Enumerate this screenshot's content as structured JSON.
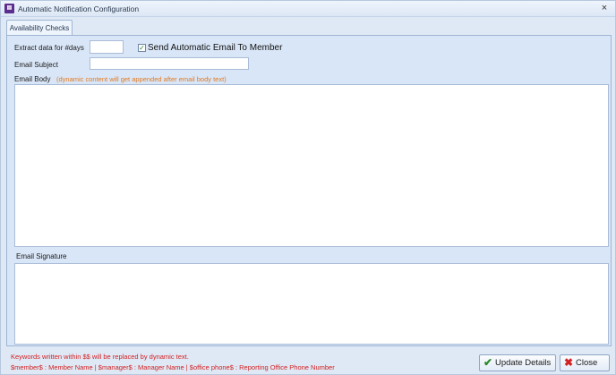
{
  "window": {
    "title": "Automatic Notification Configuration",
    "app_icon": "purple-app-icon",
    "close_icon": "×"
  },
  "tabs": [
    {
      "label": "Availability Checks",
      "active": true
    }
  ],
  "form": {
    "extract_days_label": "Extract data for #days",
    "extract_days_value": "",
    "send_email_checkbox_label": "Send Automatic Email To Member",
    "send_email_checked": true,
    "check_mark": "✓",
    "email_subject_label": "Email Subject",
    "email_subject_value": "",
    "email_body_label": "Email Body",
    "email_body_hint": "(dynamic content will get appended after email body text)",
    "email_body_value": "",
    "email_signature_label": "Email Signature",
    "email_signature_value": ""
  },
  "footer": {
    "keywords_note": "Keywords written within $$ will be replaced by dynamic text.",
    "keywords_list": "$member$ : Member Name  |  $manager$ : Manager Name  |  $office phone$ : Reporting Office Phone Number",
    "update_button_label": "Update Details",
    "update_icon": "✔",
    "close_button_label": "Close",
    "close_icon": "✖"
  },
  "colors": {
    "hint": "#e07a22",
    "note": "#d32020",
    "check": "#2a7a2a",
    "close_x": "#d32020"
  }
}
